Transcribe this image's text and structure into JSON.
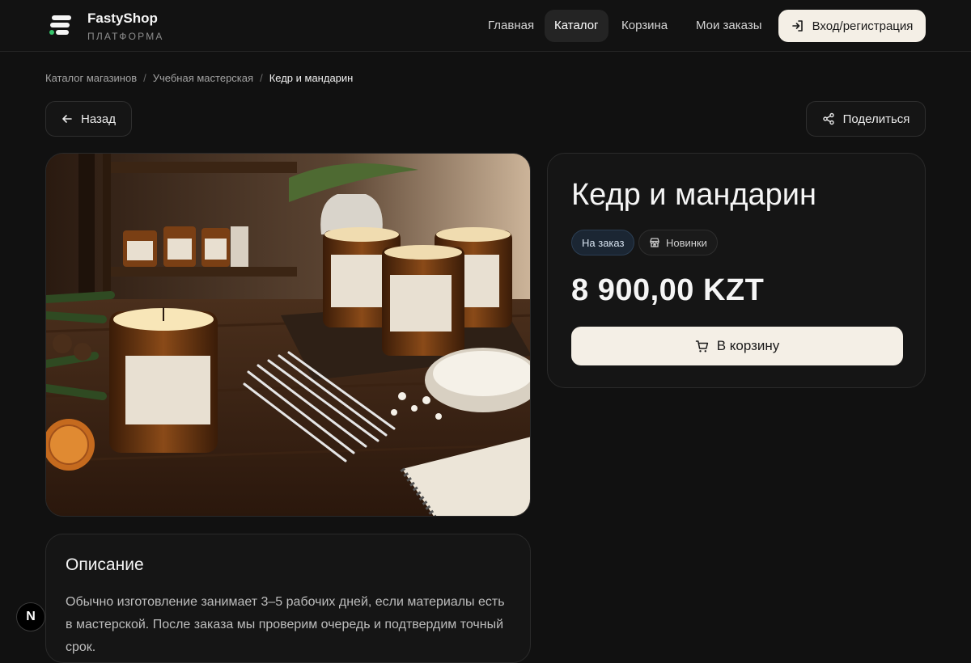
{
  "brand": {
    "name": "FastyShop",
    "subtitle": "ПЛАТФОРМА",
    "logo_icon": "logo-icon"
  },
  "nav": {
    "items": [
      {
        "label": "Главная",
        "active": false
      },
      {
        "label": "Каталог",
        "active": true
      },
      {
        "label": "Корзина",
        "active": false
      },
      {
        "label": "Мои заказы",
        "active": false
      }
    ],
    "login_label": "Вход/регистрация"
  },
  "breadcrumb": [
    "Каталог магазинов",
    "Учебная мастерская",
    "Кедр и мандарин"
  ],
  "actions": {
    "back_label": "Назад",
    "share_label": "Поделиться"
  },
  "product": {
    "title": "Кедр и мандарин",
    "tags": [
      "На заказ",
      "Новинки"
    ],
    "price": "8 900,00 KZT",
    "cart_label": "В корзину"
  },
  "description": {
    "title": "Описание",
    "text": "Обычно изготовление занимает 3–5 рабочих дней, если материалы есть в мастерской. После заказа мы проверим очередь и подтвердим точный срок."
  },
  "fab_label": "N",
  "colors": {
    "background": "#111111",
    "accent": "#f4efe6",
    "card": "#151515"
  }
}
